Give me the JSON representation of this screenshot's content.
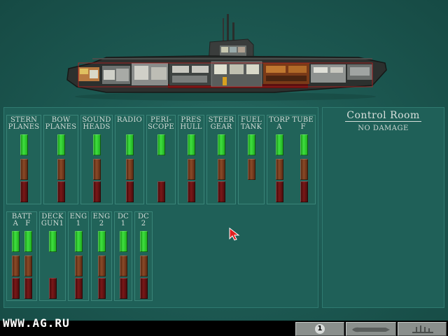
{
  "watermark": "WWW.AG.RU",
  "room": {
    "title": "Control Room",
    "status": "NO DAMAGE"
  },
  "systems_row1": [
    {
      "id": "stern-planes",
      "label": "STERN\nPLANES",
      "lamps": [
        "green",
        "brown",
        "red"
      ]
    },
    {
      "id": "bow-planes",
      "label": "BOW\nPLANES",
      "lamps": [
        "green",
        "brown",
        "red"
      ]
    },
    {
      "id": "sound-heads",
      "label": "SOUND\nHEADS",
      "lamps": [
        "green",
        "brown",
        "red"
      ]
    },
    {
      "id": "radio",
      "label": "RADIO",
      "lamps": [
        "green",
        "brown",
        "red"
      ]
    },
    {
      "id": "periscope",
      "label": "PERI-\nSCOPE",
      "lamps": [
        "green",
        "none",
        "red"
      ]
    },
    {
      "id": "pres-hull",
      "label": "PRES\nHULL",
      "lamps": [
        "green",
        "brown",
        "red"
      ]
    },
    {
      "id": "steer-gear",
      "label": "STEER\nGEAR",
      "lamps": [
        "green",
        "brown",
        "red"
      ]
    },
    {
      "id": "fuel-tank",
      "label": "FUEL\nTANK",
      "lamps": [
        "green",
        "brown",
        "none"
      ]
    },
    {
      "id": "torp-tube",
      "label": "TORP TUBE\nA        F",
      "lamps2": [
        [
          "green",
          "brown",
          "red"
        ],
        [
          "green",
          "brown",
          "red"
        ]
      ]
    }
  ],
  "systems_row2": [
    {
      "id": "batt",
      "label": "BATT\nA   F",
      "lamps2": [
        [
          "green",
          "brown",
          "red"
        ],
        [
          "green",
          "brown",
          "red"
        ]
      ]
    },
    {
      "id": "deck-gun",
      "label": "DECK\nGUN1",
      "lamps": [
        "green",
        "none",
        "red"
      ]
    },
    {
      "id": "eng-1",
      "label": "ENG\n1",
      "lamps": [
        "green",
        "brown",
        "red"
      ]
    },
    {
      "id": "eng-2",
      "label": "ENG\n2",
      "lamps": [
        "green",
        "brown",
        "red"
      ]
    },
    {
      "id": "dc-1",
      "label": "DC\n1",
      "lamps": [
        "green",
        "brown",
        "red"
      ]
    },
    {
      "id": "dc-2",
      "label": "DC\n2",
      "lamps": [
        "green",
        "brown",
        "red"
      ]
    }
  ],
  "toolbar": {
    "count": "1"
  },
  "colors": {
    "lamp_green": "#3fe03f",
    "lamp_brown": "#8a4a28",
    "lamp_red": "#7a1818",
    "panel": "#1f6058"
  }
}
